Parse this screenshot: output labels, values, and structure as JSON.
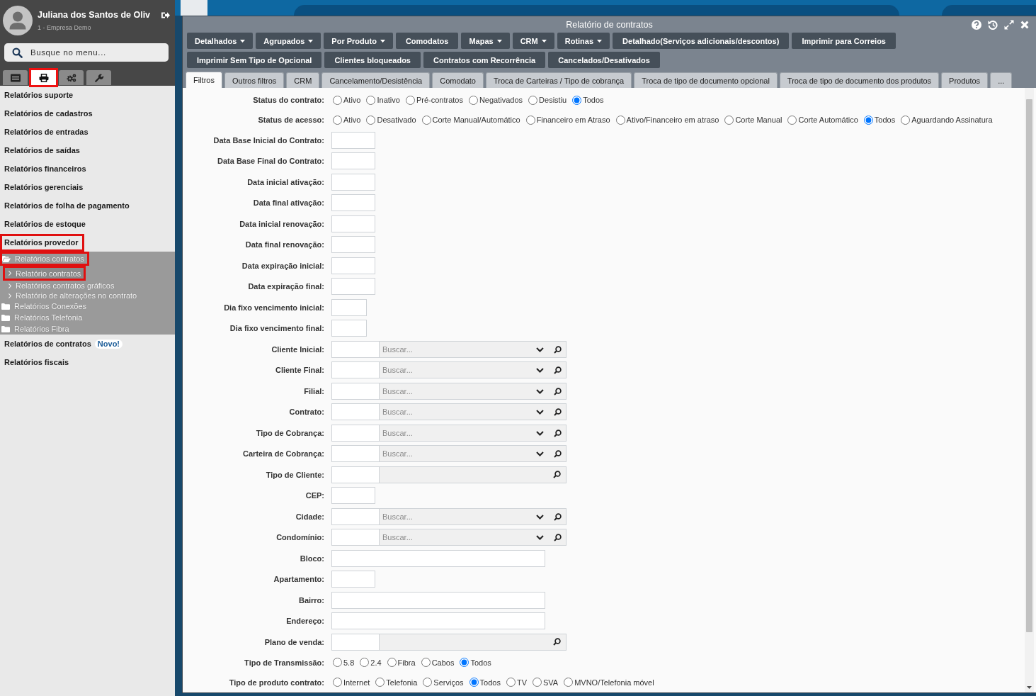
{
  "sidebar": {
    "user": {
      "name": "Juliana dos Santos de Oliv",
      "company": "1 - Empresa Demo"
    },
    "search": {
      "placeholder": "Busque no menu..."
    },
    "tabs": [
      {
        "kind": "list",
        "selected": false,
        "highlighted": false
      },
      {
        "kind": "print",
        "selected": true,
        "highlighted": true
      },
      {
        "kind": "gears",
        "selected": false,
        "highlighted": false
      },
      {
        "kind": "wrench",
        "selected": false,
        "highlighted": false
      }
    ],
    "menu": [
      {
        "label": "Relatórios suporte",
        "highlighted": false
      },
      {
        "label": "Relatórios de cadastros",
        "highlighted": false
      },
      {
        "label": "Relatórios de entradas",
        "highlighted": false
      },
      {
        "label": "Relatórios de saídas",
        "highlighted": false
      },
      {
        "label": "Relatórios financeiros",
        "highlighted": false
      },
      {
        "label": "Relatórios gerenciais",
        "highlighted": false
      },
      {
        "label": "Relatórios de folha de pagamento",
        "highlighted": false
      },
      {
        "label": "Relatórios de estoque",
        "highlighted": false
      },
      {
        "label": "Relatórios provedor",
        "highlighted": true,
        "children": [
          {
            "label": "Relatórios contratos",
            "kind": "folder",
            "expanded": true,
            "highlighted": true,
            "children": [
              {
                "label": "Relatório contratos",
                "kind": "link",
                "selected": true,
                "highlighted": true
              },
              {
                "label": "Relatórios contratos gráficos",
                "kind": "link",
                "selected": false,
                "highlighted": false
              },
              {
                "label": "Relatório de alterações no contrato",
                "kind": "link",
                "selected": false,
                "highlighted": false
              }
            ]
          },
          {
            "label": "Relatórios Conexões",
            "kind": "folder",
            "expanded": false,
            "highlighted": false
          },
          {
            "label": "Relatórios Telefonia",
            "kind": "folder",
            "expanded": false,
            "highlighted": false
          },
          {
            "label": "Relatórios Fibra",
            "kind": "folder",
            "expanded": false,
            "highlighted": false
          }
        ]
      },
      {
        "label": "Relatórios de contratos",
        "highlighted": false,
        "badge": "Novo!"
      },
      {
        "label": "Relatórios fiscais",
        "highlighted": false
      }
    ]
  },
  "window": {
    "title": "Relatório de contratos",
    "toolbar_rows": [
      [
        {
          "label": "Detalhados",
          "dropdown": true
        },
        {
          "label": "Agrupados",
          "dropdown": true
        },
        {
          "label": "Por Produto",
          "dropdown": true
        },
        {
          "label": "Comodatos",
          "dropdown": false
        },
        {
          "label": "Mapas",
          "dropdown": true
        },
        {
          "label": "CRM",
          "dropdown": true
        },
        {
          "label": "Rotinas",
          "dropdown": true
        },
        {
          "label": "Detalhado(Serviços adicionais/descontos)",
          "dropdown": false
        },
        {
          "label": "Imprimir para Correios",
          "dropdown": false
        }
      ],
      [
        {
          "label": "Imprimir Sem Tipo de Opcional",
          "dropdown": false
        },
        {
          "label": "Clientes bloqueados",
          "dropdown": false
        },
        {
          "label": "Contratos com Recorrência",
          "dropdown": false
        },
        {
          "label": "Cancelados/Desativados",
          "dropdown": false
        }
      ]
    ],
    "tabs": [
      {
        "label": "Filtros",
        "selected": true
      },
      {
        "label": "Outros filtros",
        "selected": false
      },
      {
        "label": "CRM",
        "selected": false
      },
      {
        "label": "Cancelamento/Desistência",
        "selected": false
      },
      {
        "label": "Comodato",
        "selected": false
      },
      {
        "label": "Troca de Carteiras / Tipo de cobrança",
        "selected": false
      },
      {
        "label": "Troca de tipo de documento opcional",
        "selected": false
      },
      {
        "label": "Troca de tipo de documento dos produtos",
        "selected": false
      },
      {
        "label": "Produtos",
        "selected": false
      },
      {
        "label": "...",
        "selected": false
      }
    ],
    "filters": [
      {
        "label": "Status do contrato:",
        "kind": "radio",
        "options": [
          {
            "label": "Ativo",
            "selected": false
          },
          {
            "label": "Inativo",
            "selected": false
          },
          {
            "label": "Pré-contratos",
            "selected": false
          },
          {
            "label": "Negativados",
            "selected": false
          },
          {
            "label": "Desistiu",
            "selected": false
          },
          {
            "label": "Todos",
            "selected": true
          }
        ]
      },
      {
        "label": "Status de acesso:",
        "kind": "radio",
        "options": [
          {
            "label": "Ativo",
            "selected": false
          },
          {
            "label": "Desativado",
            "selected": false
          },
          {
            "label": "Corte Manual/Automático",
            "selected": false
          },
          {
            "label": "Financeiro em Atraso",
            "selected": false
          },
          {
            "label": "Ativo/Financeiro em atraso",
            "selected": false
          },
          {
            "label": "Corte Manual",
            "selected": false
          },
          {
            "label": "Corte Automático",
            "selected": false
          },
          {
            "label": "Todos",
            "selected": true
          },
          {
            "label": "Aguardando Assinatura",
            "selected": false
          }
        ]
      },
      {
        "label": "Data Base Inicial do Contrato:",
        "kind": "small"
      },
      {
        "label": "Data Base Final do Contrato:",
        "kind": "small"
      },
      {
        "label": "Data inicial ativação:",
        "kind": "small"
      },
      {
        "label": "Data final ativação:",
        "kind": "small"
      },
      {
        "label": "Data inicial renovação:",
        "kind": "small"
      },
      {
        "label": "Data final renovação:",
        "kind": "small"
      },
      {
        "label": "Data expiração inicial:",
        "kind": "small"
      },
      {
        "label": "Data expiração final:",
        "kind": "small"
      },
      {
        "label": "Dia fixo vencimento inicial:",
        "kind": "narrow"
      },
      {
        "label": "Dia fixo vencimento final:",
        "kind": "narrow"
      },
      {
        "label": "Cliente Inicial:",
        "kind": "select",
        "placeholder": "Buscar..."
      },
      {
        "label": "Cliente Final:",
        "kind": "select",
        "placeholder": "Buscar..."
      },
      {
        "label": "Filial:",
        "kind": "select",
        "placeholder": "Buscar..."
      },
      {
        "label": "Contrato:",
        "kind": "select",
        "placeholder": "Buscar..."
      },
      {
        "label": "Tipo de Cobrança:",
        "kind": "select",
        "placeholder": "Buscar..."
      },
      {
        "label": "Carteira de Cobrança:",
        "kind": "select",
        "placeholder": "Buscar..."
      },
      {
        "label": "Tipo de Cliente:",
        "kind": "lookup"
      },
      {
        "label": "CEP:",
        "kind": "small"
      },
      {
        "label": "Cidade:",
        "kind": "select",
        "placeholder": "Buscar..."
      },
      {
        "label": "Condomínio:",
        "kind": "select",
        "placeholder": "Buscar..."
      },
      {
        "label": "Bloco:",
        "kind": "wide"
      },
      {
        "label": "Apartamento:",
        "kind": "small"
      },
      {
        "label": "Bairro:",
        "kind": "wide"
      },
      {
        "label": "Endereço:",
        "kind": "wide"
      },
      {
        "label": "Plano de venda:",
        "kind": "lookup"
      },
      {
        "label": "Tipo de Transmissão:",
        "kind": "radio",
        "options": [
          {
            "label": "5.8",
            "selected": false
          },
          {
            "label": "2.4",
            "selected": false
          },
          {
            "label": "Fibra",
            "selected": false
          },
          {
            "label": "Cabos",
            "selected": false
          },
          {
            "label": "Todos",
            "selected": true
          }
        ]
      },
      {
        "label": "Tipo de produto contrato:",
        "kind": "radio",
        "options": [
          {
            "label": "Internet",
            "selected": false
          },
          {
            "label": "Telefonia",
            "selected": false
          },
          {
            "label": "Serviços",
            "selected": false
          },
          {
            "label": "Todos",
            "selected": true
          },
          {
            "label": "TV",
            "selected": false
          },
          {
            "label": "SVA",
            "selected": false
          },
          {
            "label": "MVNO/Telefonia móvel",
            "selected": false
          }
        ]
      }
    ]
  }
}
